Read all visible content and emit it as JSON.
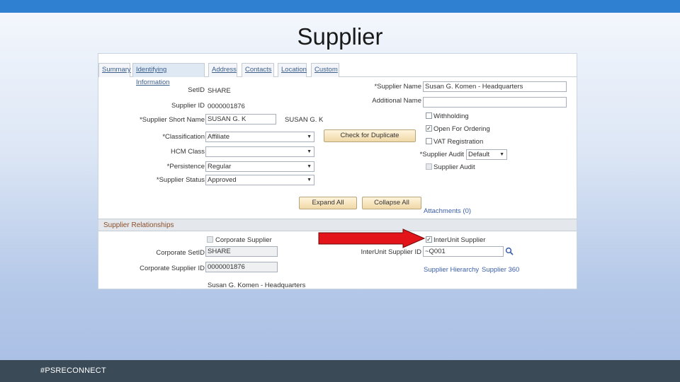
{
  "slide": {
    "title": "Supplier",
    "footer": "#PSRECONNECT"
  },
  "tabs": [
    {
      "label": "Summary"
    },
    {
      "label": "Identifying Information"
    },
    {
      "label": "Address"
    },
    {
      "label": "Contacts"
    },
    {
      "label": "Location"
    },
    {
      "label": "Custom"
    }
  ],
  "form": {
    "setid_label": "SetID",
    "setid_value": "SHARE",
    "supplier_id_label": "Supplier ID",
    "supplier_id_value": "0000001876",
    "short_name_label": "*Supplier Short Name",
    "short_name_value": "SUSAN G. K",
    "short_name_display": "SUSAN G. K",
    "classification_label": "*Classification",
    "classification_value": "Affiliate",
    "hcm_class_label": "HCM Class",
    "hcm_class_value": "",
    "persistence_label": "*Persistence",
    "persistence_value": "Regular",
    "status_label": "*Supplier Status",
    "status_value": "Approved",
    "supplier_name_label": "*Supplier Name",
    "supplier_name_value": "Susan G. Komen - Headquarters",
    "additional_name_label": "Additional Name",
    "additional_name_value": "",
    "check_duplicate_label": "Check for Duplicate",
    "withholding_label": "Withholding",
    "open_for_ordering_label": "Open For Ordering",
    "vat_registration_label": "VAT Registration",
    "supplier_audit_field_label": "*Supplier Audit",
    "supplier_audit_value": "Default",
    "supplier_audit_cb_label": "Supplier Audit",
    "expand_all_label": "Expand All",
    "collapse_all_label": "Collapse All",
    "attachments_label": "Attachments (0)"
  },
  "relationships": {
    "header": "Supplier Relationships",
    "corporate_supplier_label": "Corporate Supplier",
    "corporate_setid_label": "Corporate SetID",
    "corporate_setid_value": "SHARE",
    "corporate_supplier_id_label": "Corporate Supplier ID",
    "corporate_supplier_id_value": "0000001876",
    "corporate_name": "Susan G. Komen - Headquarters",
    "interunit_supplier_label": "InterUnit Supplier",
    "interunit_supplier_id_label": "InterUnit Supplier ID",
    "interunit_supplier_id_value": "~Q001",
    "supplier_hierarchy_label": "Supplier Hierarchy",
    "supplier_360_label": "Supplier 360"
  },
  "icons": {
    "lookup": "magnifier-icon",
    "dropdown": "chevron-down-icon",
    "check": "checkmark-icon",
    "arrow": "red-arrow-right-icon"
  },
  "colors": {
    "topbar": "#2f80d1",
    "footer": "#3a4a57",
    "arrow": "#e3141a",
    "link": "#3a5ea8",
    "section_header_text": "#8a4f2a"
  }
}
